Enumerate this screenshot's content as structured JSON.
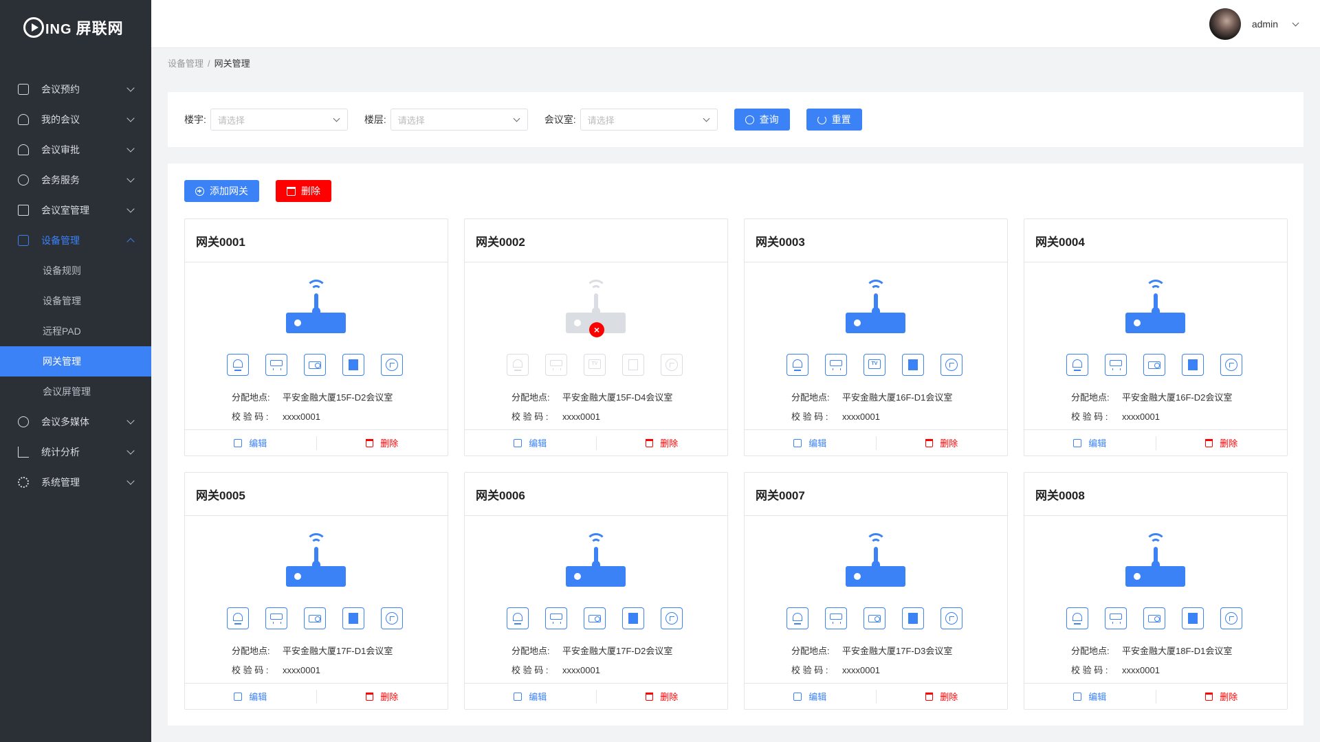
{
  "brand": {
    "prefix": "ING",
    "name": "屏联网"
  },
  "header": {
    "username": "admin"
  },
  "sidebar": {
    "items": [
      {
        "label": "会议预约",
        "icon": "calendar-icon"
      },
      {
        "label": "我的会议",
        "icon": "user-icon"
      },
      {
        "label": "会议审批",
        "icon": "stamp-icon"
      },
      {
        "label": "会务服务",
        "icon": "service-icon"
      },
      {
        "label": "会议室管理",
        "icon": "room-icon"
      },
      {
        "label": "设备管理",
        "icon": "device-icon",
        "expanded": true
      },
      {
        "label": "会议多媒体",
        "icon": "media-icon"
      },
      {
        "label": "统计分析",
        "icon": "chart-icon"
      },
      {
        "label": "系统管理",
        "icon": "gear-icon"
      }
    ],
    "sub_items": [
      "设备规则",
      "设备管理",
      "远程PAD",
      "网关管理",
      "会议屏管理"
    ],
    "active_sub": "网关管理"
  },
  "breadcrumb": {
    "parent": "设备管理",
    "separator": "/",
    "current": "网关管理"
  },
  "filter": {
    "building_label": "楼宇:",
    "floor_label": "楼层:",
    "room_label": "会议室:",
    "placeholder": "请选择",
    "query_label": "查询",
    "reset_label": "重置"
  },
  "actions": {
    "add_label": "添加网关",
    "delete_label": "删除"
  },
  "card_labels": {
    "location": "分配地点:",
    "code": "校 验 码 :",
    "edit": "编辑",
    "delete": "删除"
  },
  "gateways": [
    {
      "name": "网关0001",
      "location": "平安金融大厦15F-D2会议室",
      "code": "xxxx0001",
      "online": true,
      "devices": [
        "light",
        "ac",
        "projector",
        "curtain",
        "socket"
      ]
    },
    {
      "name": "网关0002",
      "location": "平安金融大厦15F-D4会议室",
      "code": "xxxx0001",
      "online": false,
      "devices": [
        "light",
        "ac",
        "tv",
        "curtain",
        "socket"
      ]
    },
    {
      "name": "网关0003",
      "location": "平安金融大厦16F-D1会议室",
      "code": "xxxx0001",
      "online": true,
      "devices": [
        "light",
        "ac",
        "tv",
        "curtain",
        "socket"
      ]
    },
    {
      "name": "网关0004",
      "location": "平安金融大厦16F-D2会议室",
      "code": "xxxx0001",
      "online": true,
      "devices": [
        "light",
        "ac",
        "projector",
        "curtain",
        "socket"
      ]
    },
    {
      "name": "网关0005",
      "location": "平安金融大厦17F-D1会议室",
      "code": "xxxx0001",
      "online": true,
      "devices": [
        "light",
        "ac",
        "projector",
        "curtain",
        "socket"
      ]
    },
    {
      "name": "网关0006",
      "location": "平安金融大厦17F-D2会议室",
      "code": "xxxx0001",
      "online": true,
      "devices": [
        "light",
        "ac",
        "projector",
        "curtain",
        "socket"
      ]
    },
    {
      "name": "网关0007",
      "location": "平安金融大厦17F-D3会议室",
      "code": "xxxx0001",
      "online": true,
      "devices": [
        "light",
        "ac",
        "projector",
        "curtain",
        "socket"
      ]
    },
    {
      "name": "网关0008",
      "location": "平安金融大厦18F-D1会议室",
      "code": "xxxx0001",
      "online": true,
      "devices": [
        "light",
        "ac",
        "projector",
        "curtain",
        "socket"
      ]
    }
  ],
  "colors": {
    "accent": "#3b82f6",
    "danger": "#ff0000",
    "sidebar": "#2b2f36",
    "offline": "#dadde2"
  }
}
